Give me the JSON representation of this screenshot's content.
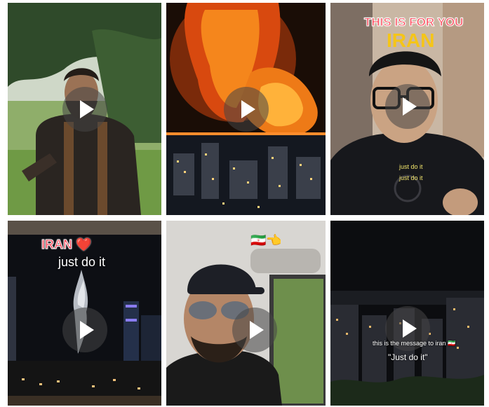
{
  "grid": {
    "tiles": [
      {
        "id": "warrior",
        "captions": []
      },
      {
        "id": "explosion",
        "captions": []
      },
      {
        "id": "glasses-man",
        "captions": [
          "THIS IS FOR YOU",
          "IRAN",
          "just do it",
          "just do it"
        ]
      },
      {
        "id": "night-smoke",
        "captions": [
          "IRAN ❤️",
          "just do it"
        ]
      },
      {
        "id": "car-selfie",
        "captions": [
          "🇮🇷👈"
        ]
      },
      {
        "id": "night-city",
        "captions": [
          "this is the message to iran 🇮🇷",
          "\"Just do it\""
        ]
      }
    ]
  },
  "icons": {
    "play": "play-icon"
  },
  "colors": {
    "caption_red": "#ff3b4e",
    "caption_yellow": "#f5c518",
    "overlay": "#464646"
  }
}
